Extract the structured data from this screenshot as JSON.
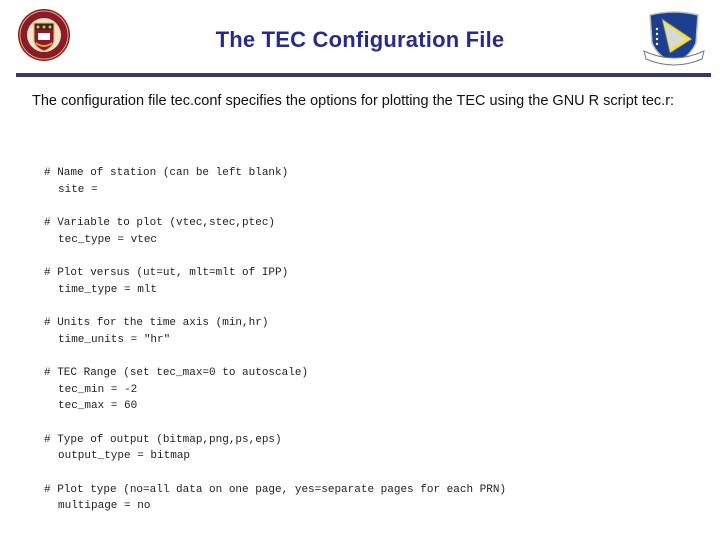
{
  "header": {
    "title": "The TEC Configuration File",
    "left_logo": "boston-college-seal",
    "right_logo": "air-force-research-laboratory-shield",
    "divider_color": "#34386e",
    "title_color": "#2a2a8c"
  },
  "intro": "The configuration file tec.conf specifies the options for plotting the TEC using the GNU R script tec.r:",
  "config_blocks": [
    {
      "comment": "# Name of station (can be left blank)",
      "settings": [
        "site ="
      ]
    },
    {
      "comment": "# Variable to plot (vtec,stec,ptec)",
      "settings": [
        "tec_type = vtec"
      ]
    },
    {
      "comment": "# Plot versus (ut=ut, mlt=mlt of IPP)",
      "settings": [
        "time_type = mlt"
      ]
    },
    {
      "comment": "# Units for the time axis (min,hr)",
      "settings": [
        "time_units = \"hr\""
      ]
    },
    {
      "comment": "# TEC Range (set tec_max=0 to autoscale)",
      "settings": [
        "tec_min = -2",
        "tec_max = 60"
      ]
    },
    {
      "comment": "# Type of output (bitmap,png,ps,eps)",
      "settings": [
        "output_type = bitmap"
      ]
    },
    {
      "comment": "# Plot type (no=all data on one page, yes=separate pages for each PRN)",
      "settings": [
        "multipage = no"
      ]
    }
  ]
}
